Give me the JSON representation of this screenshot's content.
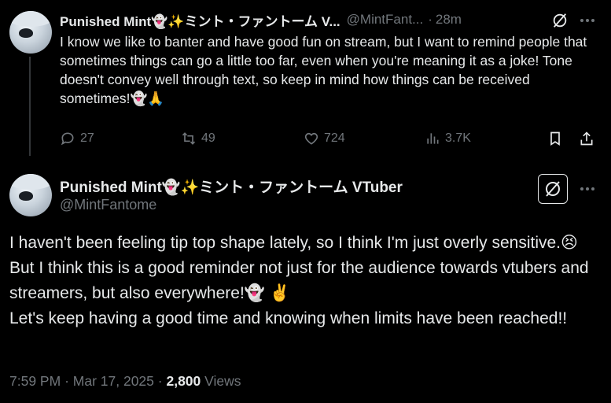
{
  "tweet1": {
    "author_name": "Punished Mint👻✨ミント・ファントーム V...",
    "handle": "@MintFant...",
    "separator": "·",
    "time": "28m",
    "text": "I know we like to banter and have good fun on stream, but I want to remind people that sometimes things can go a little too far, even when you're meaning it as a joke! Tone doesn't convey well through text, so keep in mind how things can be received sometimes!👻🙏",
    "replies": "27",
    "reposts": "49",
    "likes": "724",
    "views": "3.7K"
  },
  "tweet2": {
    "author_name": "Punished Mint👻✨ミント・ファントーム VTuber",
    "handle": "@MintFantome",
    "text_lines": [
      "I haven't been feeling tip top shape lately, so I think I'm just overly sensitive.😣 But I think this is a good reminder not just for the audience towards vtubers and streamers, but also everywhere!👻 ✌️",
      "Let's keep having a good time and knowing when limits have been reached!!"
    ],
    "time": "7:59 PM",
    "dot": "·",
    "date": "Mar 17, 2025",
    "view_count": "2,800",
    "views_label": "Views"
  },
  "colors": {
    "background": "#000000",
    "text": "#e7e9ea",
    "muted": "#71767b",
    "divider": "#333639"
  },
  "icons": [
    "grok-icon",
    "more-icon",
    "reply-icon",
    "repost-icon",
    "like-icon",
    "views-icon",
    "bookmark-icon",
    "share-icon"
  ]
}
